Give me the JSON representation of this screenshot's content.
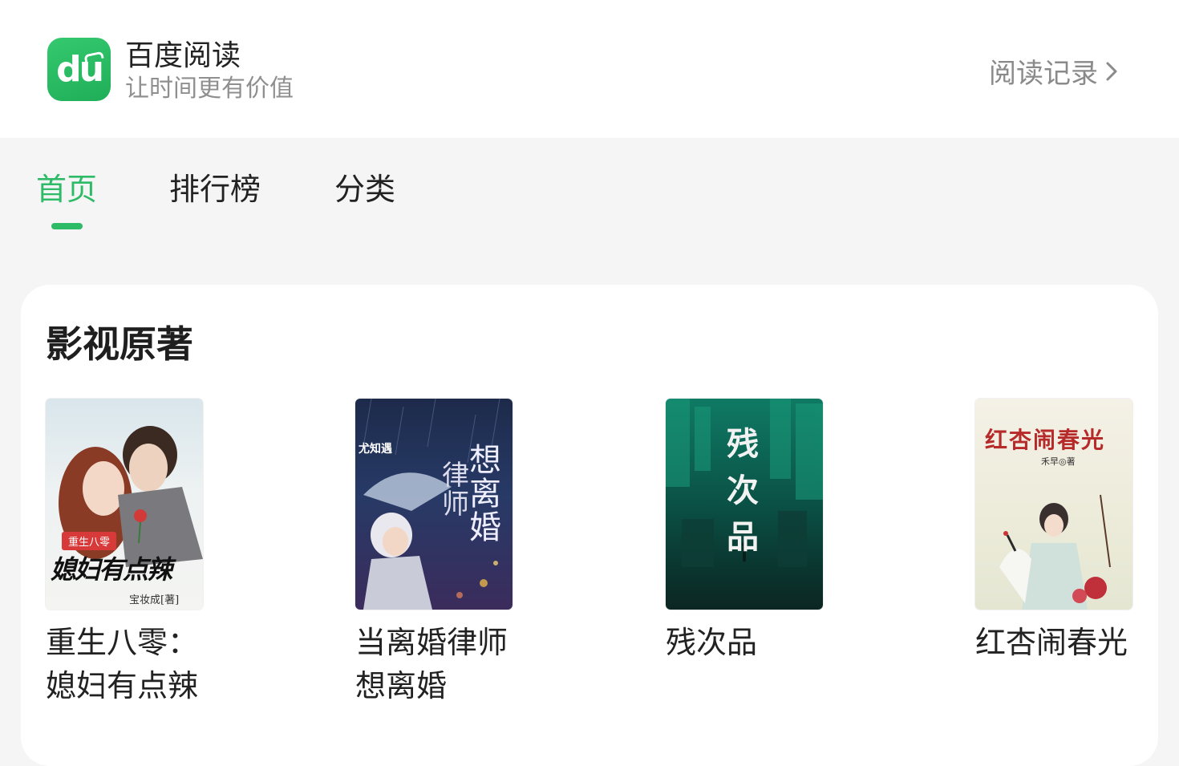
{
  "header": {
    "logo_text": "du",
    "app_name": "百度阅读",
    "slogan": "让时间更有价值",
    "history_label": "阅读记录"
  },
  "tabs": [
    {
      "label": "首页",
      "active": true
    },
    {
      "label": "排行榜",
      "active": false
    },
    {
      "label": "分类",
      "active": false
    }
  ],
  "section": {
    "title": "影视原著",
    "books": [
      {
        "title": "重生八零：媳妇有点辣",
        "cover_badge": "重生八零",
        "cover_title": "媳妇有点辣",
        "cover_author": "宝妆成[著]"
      },
      {
        "title": "当离婚律师想离婚",
        "cover_title": "想离婚",
        "cover_subtitle": "律师",
        "cover_author": "尤知遇"
      },
      {
        "title": "残次品",
        "cover_title": "残次品"
      },
      {
        "title": "红杏闹春光",
        "cover_title": "红杏闹春光",
        "cover_author": "禾早◎著"
      }
    ]
  },
  "colors": {
    "accent": "#2dbb68",
    "header_bg": "#ffffff",
    "page_bg": "#f5f5f5",
    "text_primary": "#222222",
    "text_secondary": "#8f8f8f"
  }
}
